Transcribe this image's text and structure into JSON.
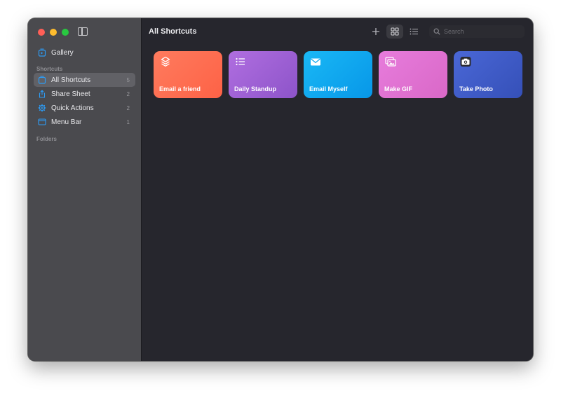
{
  "sidebar": {
    "gallery_label": "Gallery",
    "shortcuts_section": "Shortcuts",
    "folders_section": "Folders",
    "items": [
      {
        "label": "All Shortcuts",
        "count": "5",
        "icon": "all-shortcuts-icon",
        "selected": true
      },
      {
        "label": "Share Sheet",
        "count": "2",
        "icon": "share-sheet-icon",
        "selected": false
      },
      {
        "label": "Quick Actions",
        "count": "2",
        "icon": "gear-icon",
        "selected": false
      },
      {
        "label": "Menu Bar",
        "count": "1",
        "icon": "menu-bar-icon",
        "selected": false
      }
    ]
  },
  "toolbar": {
    "title": "All Shortcuts",
    "search_placeholder": "Search"
  },
  "shortcuts": [
    {
      "title": "Email a friend",
      "icon": "layers-icon",
      "color_from": "#ff7b5e",
      "color_to": "#fd6246"
    },
    {
      "title": "Daily Standup",
      "icon": "list-icon",
      "color_from": "#b06ee0",
      "color_to": "#8d54c9"
    },
    {
      "title": "Email Myself",
      "icon": "envelope-icon",
      "color_from": "#1ab8f5",
      "color_to": "#0797e8"
    },
    {
      "title": "Make GIF",
      "icon": "photos-icon",
      "color_from": "#e77cdc",
      "color_to": "#d968c7"
    },
    {
      "title": "Take Photo",
      "icon": "camera-icon",
      "color_from": "#4a67d6",
      "color_to": "#3550b8"
    }
  ],
  "colors": {
    "accent": "#2d9cf5",
    "sidebar_bg": "#4a4a4e",
    "main_bg": "#26262d"
  }
}
